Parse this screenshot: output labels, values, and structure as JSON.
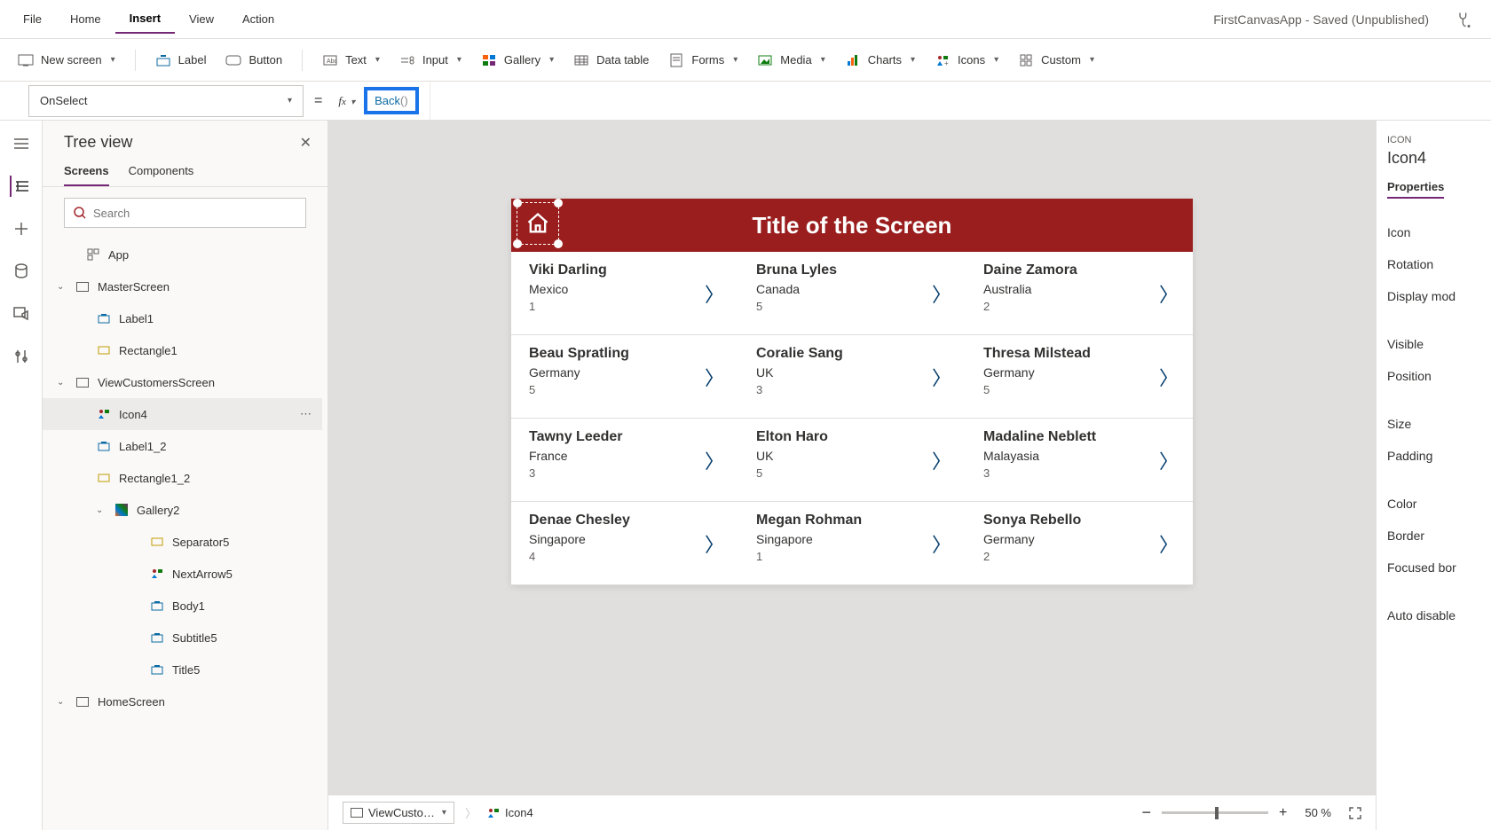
{
  "menubar": {
    "items": [
      "File",
      "Home",
      "Insert",
      "View",
      "Action"
    ],
    "active": "Insert",
    "app_title": "FirstCanvasApp - Saved (Unpublished)"
  },
  "ribbon": {
    "new_screen": "New screen",
    "label": "Label",
    "button": "Button",
    "text": "Text",
    "input": "Input",
    "gallery": "Gallery",
    "data_table": "Data table",
    "forms": "Forms",
    "media": "Media",
    "charts": "Charts",
    "icons": "Icons",
    "custom": "Custom"
  },
  "formula": {
    "property": "OnSelect",
    "fn": "Back",
    "parens": "()"
  },
  "tree": {
    "title": "Tree view",
    "tabs": [
      "Screens",
      "Components"
    ],
    "search_placeholder": "Search",
    "nodes": {
      "app": "App",
      "master": "MasterScreen",
      "label1": "Label1",
      "rect1": "Rectangle1",
      "viewcust": "ViewCustomersScreen",
      "icon4": "Icon4",
      "label12": "Label1_2",
      "rect12": "Rectangle1_2",
      "gallery2": "Gallery2",
      "sep5": "Separator5",
      "next5": "NextArrow5",
      "body1": "Body1",
      "subtitle5": "Subtitle5",
      "title5": "Title5",
      "home": "HomeScreen"
    }
  },
  "canvas": {
    "screen_title": "Title of the Screen",
    "items": [
      {
        "name": "Viki Darling",
        "country": "Mexico",
        "num": "1"
      },
      {
        "name": "Bruna Lyles",
        "country": "Canada",
        "num": "5"
      },
      {
        "name": "Daine Zamora",
        "country": "Australia",
        "num": "2"
      },
      {
        "name": "Beau Spratling",
        "country": "Germany",
        "num": "5"
      },
      {
        "name": "Coralie Sang",
        "country": "UK",
        "num": "3"
      },
      {
        "name": "Thresa Milstead",
        "country": "Germany",
        "num": "5"
      },
      {
        "name": "Tawny Leeder",
        "country": "France",
        "num": "3"
      },
      {
        "name": "Elton Haro",
        "country": "UK",
        "num": "5"
      },
      {
        "name": "Madaline Neblett",
        "country": "Malayasia",
        "num": "3"
      },
      {
        "name": "Denae Chesley",
        "country": "Singapore",
        "num": "4"
      },
      {
        "name": "Megan Rohman",
        "country": "Singapore",
        "num": "1"
      },
      {
        "name": "Sonya Rebello",
        "country": "Germany",
        "num": "2"
      }
    ]
  },
  "status": {
    "crumb1": "ViewCusto…",
    "crumb2": "Icon4",
    "zoom": "50 %"
  },
  "props": {
    "section": "ICON",
    "name": "Icon4",
    "tab": "Properties",
    "rows": [
      "Icon",
      "Rotation",
      "Display mod",
      "Visible",
      "Position",
      "Size",
      "Padding",
      "Color",
      "Border",
      "Focused bor",
      "Auto disable"
    ]
  }
}
